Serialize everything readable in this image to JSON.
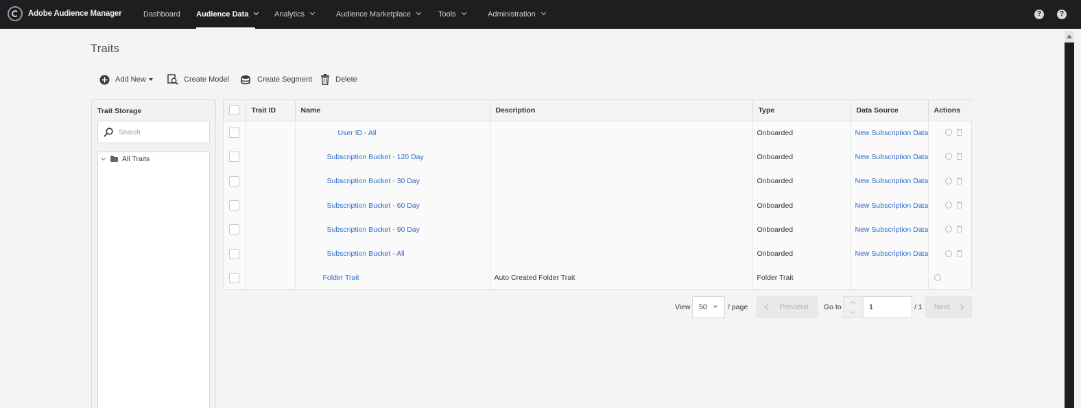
{
  "app": {
    "title": "Adobe Audience Manager"
  },
  "nav": {
    "items": [
      {
        "label": "Dashboard",
        "dropdown": false,
        "active": false
      },
      {
        "label": "Audience Data",
        "dropdown": true,
        "active": true
      },
      {
        "label": "Analytics",
        "dropdown": true,
        "active": false
      },
      {
        "label": "Audience Marketplace",
        "dropdown": true,
        "active": false
      },
      {
        "label": "Tools",
        "dropdown": true,
        "active": false
      },
      {
        "label": "Administration",
        "dropdown": true,
        "active": false
      }
    ],
    "help_glyph": "?",
    "account_glyph": "?"
  },
  "page": {
    "title": "Traits"
  },
  "toolbar": {
    "add_new": "Add New",
    "create_model": "Create Model",
    "create_segment": "Create Segment",
    "delete": "Delete"
  },
  "storage": {
    "title": "Trait Storage",
    "search_placeholder": "Search",
    "root_folder": "All Traits"
  },
  "table": {
    "columns": [
      "Trait ID",
      "Name",
      "Description",
      "Type",
      "Data Source",
      "Actions"
    ],
    "rows": [
      {
        "id": "",
        "name": "User ID - All",
        "description": "",
        "type": "Onboarded",
        "data_source": "New Subscription Data",
        "indent": 2,
        "actions": [
          "edit-icon",
          "delete-icon"
        ]
      },
      {
        "id": "",
        "name": "Subscription Bucket - 120 Day",
        "description": "",
        "type": "Onboarded",
        "data_source": "New Subscription Data",
        "indent": 1,
        "actions": [
          "edit-icon",
          "delete-icon"
        ]
      },
      {
        "id": "",
        "name": "Subscription Bucket - 30 Day",
        "description": "",
        "type": "Onboarded",
        "data_source": "New Subscription Data",
        "indent": 1,
        "actions": [
          "edit-icon",
          "delete-icon"
        ]
      },
      {
        "id": "",
        "name": "Subscription Bucket - 60 Day",
        "description": "",
        "type": "Onboarded",
        "data_source": "New Subscription Data",
        "indent": 1,
        "actions": [
          "edit-icon",
          "delete-icon"
        ]
      },
      {
        "id": "",
        "name": "Subscription Bucket - 90 Day",
        "description": "",
        "type": "Onboarded",
        "data_source": "New Subscription Data",
        "indent": 1,
        "actions": [
          "edit-icon",
          "delete-icon"
        ]
      },
      {
        "id": "",
        "name": "Subscription Bucket - All",
        "description": "",
        "type": "Onboarded",
        "data_source": "New Subscription Data",
        "indent": 1,
        "actions": [
          "edit-icon",
          "delete-icon"
        ]
      },
      {
        "id": "",
        "name": "Folder Trait",
        "description": "Auto Created Folder Trait",
        "type": "Folder Trait",
        "data_source": "",
        "indent": 0,
        "actions": [
          "edit-icon"
        ]
      }
    ]
  },
  "pagination": {
    "view_label": "View",
    "per_page_value": "50",
    "per_page_suffix": "/ page",
    "previous": "Previous",
    "goto_label": "Go to",
    "page_value": "1",
    "total_label": "/ 1",
    "next": "Next"
  },
  "colors": {
    "nav_bg": "#1e1e1e",
    "link": "#2f6ac6",
    "page_bg": "#f4f4f4"
  }
}
